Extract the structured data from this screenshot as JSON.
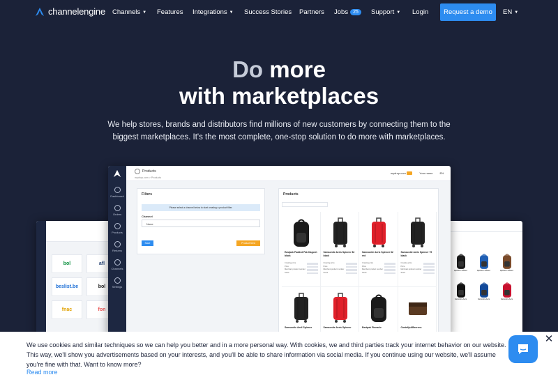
{
  "brand": {
    "logo_text": "channelengine"
  },
  "nav": {
    "channels": "Channels",
    "features": "Features",
    "integrations": "Integrations",
    "success_stories": "Success Stories",
    "partners": "Partners",
    "jobs": "Jobs",
    "jobs_count": "25",
    "support": "Support",
    "login": "Login",
    "request_demo": "Request a demo",
    "language": "EN"
  },
  "hero": {
    "title_line1_muted": "Do",
    "title_line1_rest": " more",
    "title_line2": "with marketplaces",
    "subtitle": "We help stores, brands and distributors find millions of new customers by connecting them to the biggest marketplaces. It's the most complete, one-stop solution to do more with marketplaces."
  },
  "app_mock": {
    "page_title": "Products",
    "breadcrumb": "mydrop.com > Products",
    "store": "mydrop.com",
    "user": "Your name",
    "lang": "EN",
    "sidebar": [
      "Dashboard",
      "Orders",
      "Products",
      "Returns",
      "Channels",
      "Settings"
    ],
    "filters": {
      "title": "Filters",
      "info": "Please select a channel below to start creating a product filter.",
      "channel_label": "Channel",
      "channel_value": "None",
      "save": "Save",
      "extra_btn": "Product feed"
    },
    "products": {
      "title": "Products",
      "meta_labels": [
        "Creating price",
        "Price",
        "Merchant product number",
        "Stock"
      ],
      "items": [
        {
          "name": "Eastpak Padded Pak Dagosh black",
          "color": "#1a1a1a",
          "kind": "backpack"
        },
        {
          "name": "Samsonite Aeris Spinner 82 black",
          "color": "#222",
          "kind": "suitcase"
        },
        {
          "name": "Samsonite Aeris Spinner 82 red",
          "color": "#e0202a",
          "kind": "suitcase"
        },
        {
          "name": "Samsonite Aeris Spinner 75 black",
          "color": "#222",
          "kind": "suitcase"
        },
        {
          "name": "Samsonite Aeril Spinner",
          "color": "#222",
          "kind": "suitcase"
        },
        {
          "name": "Samsonite Aeris Spinner",
          "color": "#e0202a",
          "kind": "suitcase"
        },
        {
          "name": "Eastpak Pinnacle",
          "color": "#1a1a1a",
          "kind": "backpack"
        },
        {
          "name": "Castelijn&Beerens",
          "color": "#5a3a22",
          "kind": "wallet"
        }
      ]
    }
  },
  "left_mock": {
    "tiles": [
      {
        "text": "bol",
        "color": "#0b8f3e"
      },
      {
        "text": "afl",
        "color": "#2d4a7a"
      },
      {
        "text": "beslist.be",
        "color": "#1d6fd6"
      },
      {
        "text": "bol",
        "color": "#222"
      },
      {
        "text": "fnac",
        "color": "#e1a100"
      },
      {
        "text": "fon",
        "color": "#e55"
      }
    ]
  },
  "right_mock": {
    "items": [
      {
        "name": "Fjällräven Kånken",
        "color": "#1a1a1a"
      },
      {
        "name": "Fjällräven Kånken",
        "color": "#1f5fb4"
      },
      {
        "name": "Fjällräven Kånken",
        "color": "#7a4a2a"
      },
      {
        "name": "Samsonite Aeris",
        "color": "#111"
      },
      {
        "name": "Samsonite Aeris",
        "color": "#124a9a"
      },
      {
        "name": "Samsonite Aeris",
        "color": "#c8102e"
      }
    ]
  },
  "cookie": {
    "text": "We use cookies and similar techniques so we can help you better and in a more personal way. With cookies, we and third parties track your internet behavior on our website. This way, we'll show you advertisements based on your interests, and you'll be able to share information via social media. If you continue using our website, we'll assume you're fine with that. Want to know more?",
    "read_more": "Read more"
  },
  "colors": {
    "accent": "#2d8cf0",
    "background": "#1b2238",
    "orange": "#f5a623"
  },
  "icons": [
    "channelengine-logo-icon",
    "chat-icon",
    "close-icon",
    "chevron-down-icon"
  ]
}
